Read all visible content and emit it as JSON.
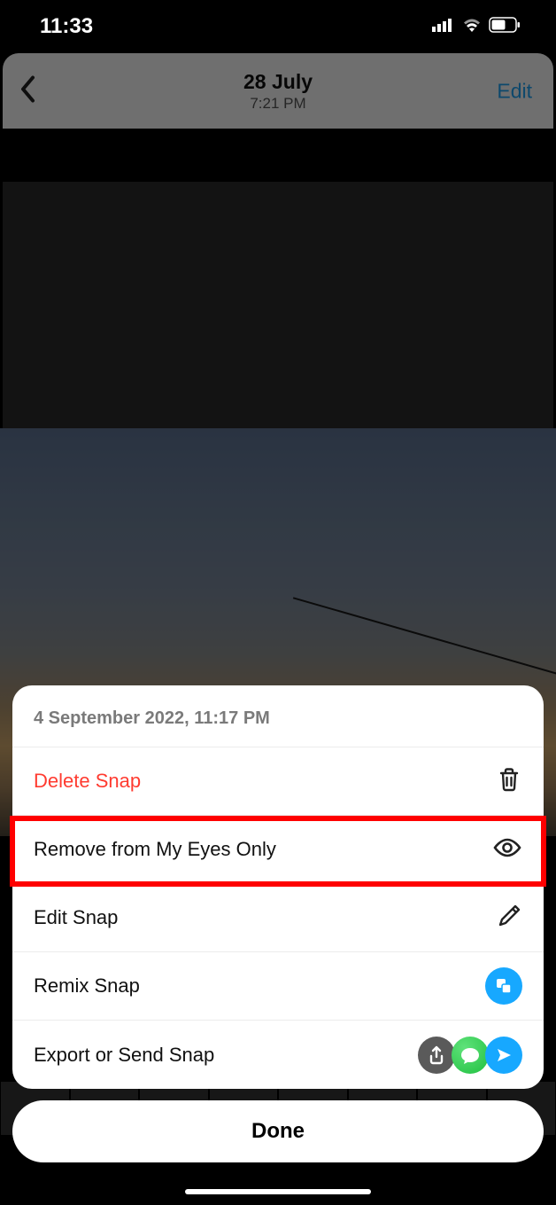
{
  "status": {
    "time": "11:33"
  },
  "header": {
    "date": "28 July",
    "time": "7:21 PM",
    "edit_label": "Edit"
  },
  "sheet": {
    "timestamp": "4 September 2022, 11:17 PM",
    "items": {
      "delete": "Delete Snap",
      "remove_eyes": "Remove from My Eyes Only",
      "edit": "Edit Snap",
      "remix": "Remix Snap",
      "export": "Export or Send Snap"
    }
  },
  "done_label": "Done"
}
